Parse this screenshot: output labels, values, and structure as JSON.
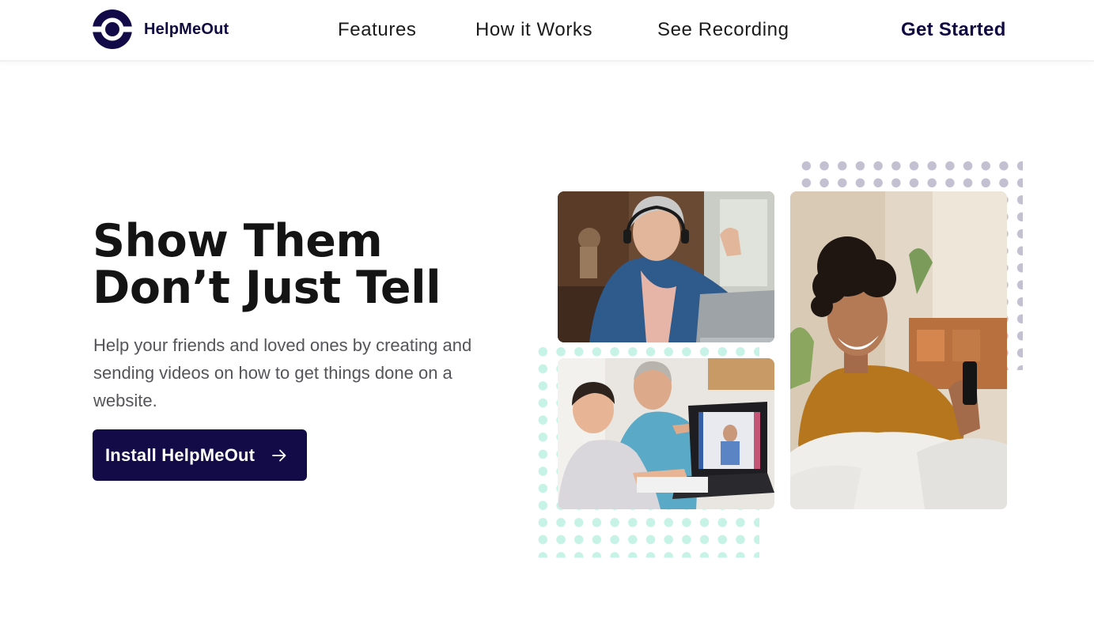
{
  "brand": {
    "name": "HelpMeOut",
    "color": "#120b48"
  },
  "nav": {
    "features": "Features",
    "how_it_works": "How it Works",
    "see_recording": "See Recording",
    "get_started": "Get Started"
  },
  "hero": {
    "title_line1": "Show Them",
    "title_line2": "Don’t Just Tell",
    "subtitle": "Help your friends and loved ones by creating and sending videos on how to get things done on a website.",
    "cta_label": "Install HelpMeOut",
    "cta_icon": "arrow-right-icon"
  },
  "images": [
    {
      "name": "woman-with-headphones-at-laptop-photo"
    },
    {
      "name": "boy-and-grandfather-at-laptop-photo"
    },
    {
      "name": "smiling-woman-with-phone-photo"
    }
  ],
  "colors": {
    "dots_purple": "#c3c1d1",
    "dots_teal": "#c6f3e6",
    "button_bg": "#120b48",
    "button_text": "#ffffff"
  }
}
